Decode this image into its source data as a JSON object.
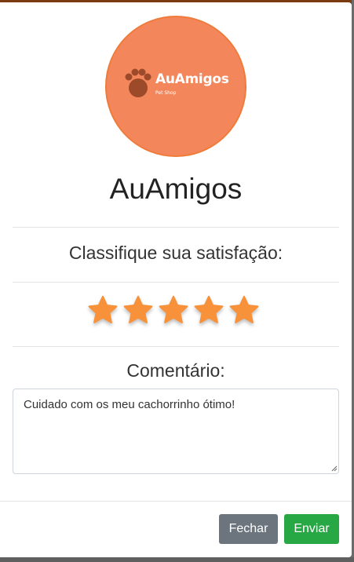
{
  "logo": {
    "brand": "AuAmigos",
    "tagline": "Pet Shop",
    "paw_icon": "paw-icon",
    "circle_color": "#f4865b",
    "paw_color": "#9c4a2a"
  },
  "title": "AuAmigos",
  "rating": {
    "label": "Classifique sua satisfação:",
    "star_icon": "star-icon",
    "max": 5,
    "value": 5,
    "star_color": "#f7913a"
  },
  "comment": {
    "label": "Comentário:",
    "value": "Cuidado com os meu cachorrinho ótimo!"
  },
  "buttons": {
    "close_label": "Fechar",
    "send_label": "Enviar"
  }
}
